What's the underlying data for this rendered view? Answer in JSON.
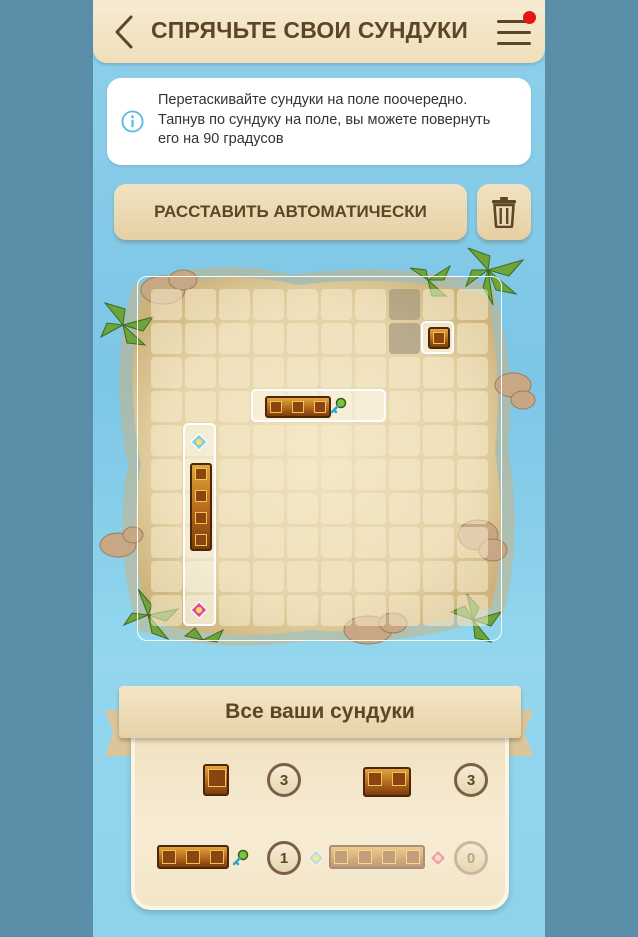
{
  "header": {
    "title": "СПРЯЧЬТЕ СВОИ СУНДУКИ",
    "menu_has_notification": true,
    "back_icon": "chevron-left-icon",
    "menu_icon": "hamburger-menu-icon"
  },
  "info": {
    "icon": "info-circle-icon",
    "lines": [
      "Перетаскивайте сундуки на поле поочередно.",
      "Тапнув по сундуку на поле, вы можете повернуть",
      "его на 90 градусов"
    ]
  },
  "actions": {
    "auto_label": "РАССТАВИТЬ АВТОМАТИЧЕСКИ",
    "trash_icon": "trash-icon"
  },
  "board": {
    "rows": 10,
    "cols": 10,
    "darkened_cells": [
      [
        0,
        7
      ],
      [
        1,
        7
      ]
    ],
    "placed_chests": [
      {
        "size": 1,
        "row": 1,
        "col": 8,
        "orientation": "vertical"
      },
      {
        "size": 3,
        "row": 3,
        "col": 3,
        "orientation": "horizontal",
        "key": true
      },
      {
        "size": 4,
        "row": 5,
        "col": 1,
        "orientation": "vertical",
        "gems": true
      }
    ]
  },
  "inventory": {
    "title": "Все ваши сундуки",
    "items": [
      {
        "name": "chest-1",
        "size": 1,
        "count": "3"
      },
      {
        "name": "chest-2",
        "size": 2,
        "count": "3"
      },
      {
        "name": "chest-3",
        "size": 3,
        "count": "1"
      },
      {
        "name": "chest-4",
        "size": 4,
        "count": "0"
      }
    ]
  },
  "colors": {
    "accent_brown": "#5d4626",
    "notification_red": "#e51515",
    "info_blue": "#59bfe2"
  }
}
